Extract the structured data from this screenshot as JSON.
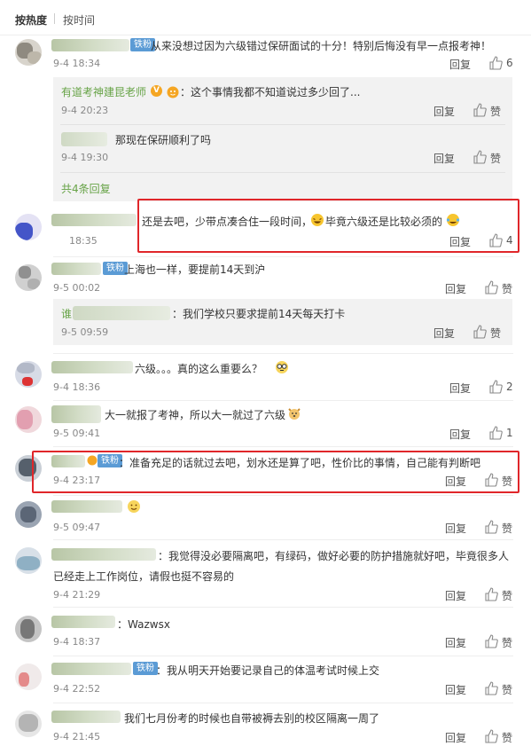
{
  "sort": {
    "hot_label": "按热度",
    "time_label": "按时间"
  },
  "labels": {
    "reply": "回复",
    "like": "赞",
    "fan_badge": "铁粉"
  },
  "comments": [
    {
      "text": "从来没想过因为六级错过保研面试的十分！特别后悔没有早一点报考神！",
      "time": "9-4 18:34",
      "likes": "6"
    },
    {
      "text": "还是去吧，少带点凑合住一段时间，",
      "text_b": "毕竟六级还是比较必须的",
      "time": "18:35",
      "likes": "4"
    },
    {
      "text": "上海也一样，要提前14天到沪",
      "time": "9-5 00:02",
      "likes": "赞"
    },
    {
      "text": "六级。。。真的这么重要么？",
      "time": "9-4 18:36",
      "likes": "2"
    },
    {
      "text": "大一就报了考神，所以大一就过了六级",
      "time": "9-5 09:41",
      "likes": "1"
    },
    {
      "text": "：准备充足的话就过去吧，划水还是算了吧，性价比的事情，自己能有判断吧",
      "time": "9-4 23:17",
      "likes": "赞"
    },
    {
      "text": "",
      "time": "9-5 09:47",
      "likes": "赞"
    },
    {
      "text": "：我觉得没必要隔离吧，有绿码，做好必要的防护措施就好吧，毕竟很多人",
      "text_b": "已经走上工作岗位，请假也挺不容易的",
      "time": "9-4 21:29",
      "likes": "赞"
    },
    {
      "text": "：Wazwsx",
      "time": "9-4 18:37",
      "likes": "赞"
    },
    {
      "text": "：我从明天开始要记录自己的体温考试时候上交",
      "time": "9-4 22:52",
      "likes": "赞"
    },
    {
      "text": "我们七月份考的时候也自带被褥去别的校区隔离一周了",
      "time": "9-4 21:45",
      "likes": "赞"
    }
  ],
  "thread1": {
    "reply1_name": "有道考神建昆老师",
    "reply1_text": "：这个事情我都不知道说过多少回了...",
    "reply1_time": "9-4 20:23",
    "reply2_text": "那现在保研顺利了吗",
    "reply2_time": "9-4 19:30",
    "more": "共4条回复"
  },
  "thread3": {
    "reply1_name": "谁",
    "reply1_text": "：我们学校只要求提前14天每天打卡",
    "reply1_time": "9-5 09:59"
  },
  "colors": {
    "highlight": "#e0262a",
    "name": "#eb7350",
    "green": "#67a347"
  }
}
